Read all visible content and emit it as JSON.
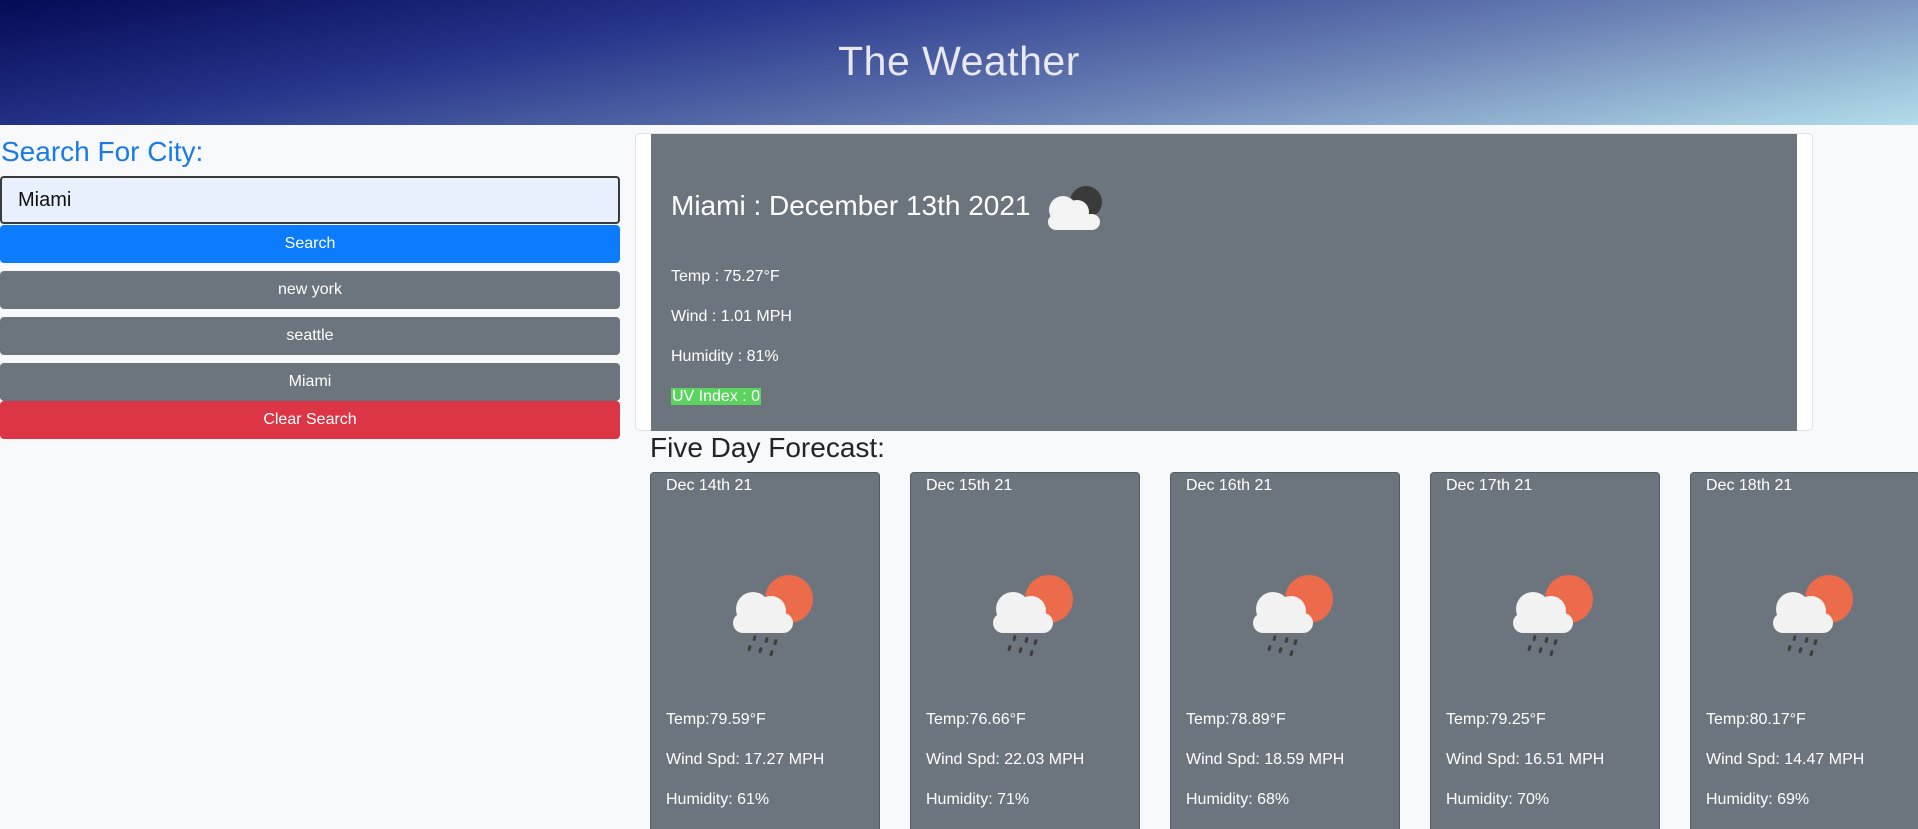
{
  "header": {
    "title": "The Weather"
  },
  "sidebar": {
    "label": "Search For City:",
    "search": {
      "value": "Miami"
    },
    "search_button": "Search",
    "history": [
      "new york",
      "seattle",
      "Miami"
    ],
    "clear_button": "Clear Search"
  },
  "current": {
    "title": "Miami : December 13th 2021",
    "icon": "partly-cloudy-night-icon",
    "temp": "Temp : 75.27°F",
    "wind": "Wind : 1.01 MPH",
    "humidity": "Humidity : 81%",
    "uv": "UV Index : 0",
    "uv_color": "#5ad35f"
  },
  "forecast": {
    "title": "Five Day Forecast:",
    "days": [
      {
        "date": "Dec 14th 21",
        "icon": "rain-sun-icon",
        "temp": "Temp:79.59°F",
        "wind": "Wind Spd: 17.27 MPH",
        "humidity": "Humidity: 61%"
      },
      {
        "date": "Dec 15th 21",
        "icon": "rain-sun-icon",
        "temp": "Temp:76.66°F",
        "wind": "Wind Spd: 22.03 MPH",
        "humidity": "Humidity: 71%"
      },
      {
        "date": "Dec 16th 21",
        "icon": "rain-sun-icon",
        "temp": "Temp:78.89°F",
        "wind": "Wind Spd: 18.59 MPH",
        "humidity": "Humidity: 68%"
      },
      {
        "date": "Dec 17th 21",
        "icon": "rain-sun-icon",
        "temp": "Temp:79.25°F",
        "wind": "Wind Spd: 16.51 MPH",
        "humidity": "Humidity: 70%"
      },
      {
        "date": "Dec 18th 21",
        "icon": "rain-sun-icon",
        "temp": "Temp:80.17°F",
        "wind": "Wind Spd: 14.47 MPH",
        "humidity": "Humidity: 69%"
      }
    ]
  },
  "colors": {
    "accent": "#1a7be6",
    "primary_button": "#0d7bfe",
    "secondary_button": "#6c757d",
    "danger_button": "#dc3545"
  }
}
